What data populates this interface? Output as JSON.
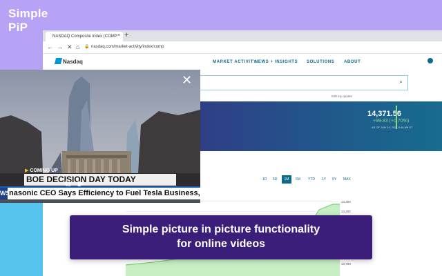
{
  "brand": {
    "line1": "Simple",
    "line2": "PiP"
  },
  "browser": {
    "tab_title": "NASDAQ Composite Index (COMP",
    "tab_close": "×",
    "new_tab": "+",
    "back": "←",
    "forward": "→",
    "reload": "✕",
    "home": "⌂",
    "lock": "🔒",
    "url": "nasdaq.com/market-activity/index/comp"
  },
  "site": {
    "logo": "Nasdaq",
    "menu": [
      "MARKET ACTIVITY",
      "NEWS + INSIGHTS",
      "SOLUTIONS",
      "ABOUT"
    ],
    "search_icon": "⌕",
    "edit_quotes": "Edit my quotes",
    "quote": {
      "price": "14,371.56",
      "change": "+99.83 (+0.70%)",
      "as_of": "AS OF JUN 24, 2021 9:46 AM ET"
    },
    "ranges": [
      "1D",
      "5D",
      "1M",
      "6M",
      "YTD",
      "1Y",
      "5Y",
      "MAX"
    ],
    "active_range": "1M",
    "y_ticks": [
      "14,300",
      "14,200",
      "13,700"
    ]
  },
  "pip": {
    "close": "✕",
    "coming_up": "COMING UP",
    "headline": "BOE DECISION DAY TODAY",
    "ticker_label": "WS",
    "ticker": "nasonic CEO Says Efficiency to Fuel Tesla Business, Growth",
    "controls": "⧉▶"
  },
  "caption": {
    "line1": "Simple picture in picture functionality",
    "line2": "for online videos"
  },
  "colors": {
    "background_purple": "#b6a3f6",
    "background_blue": "#57c4ee",
    "caption_bg": "#3b1d7a",
    "nasdaq_teal": "#0e6a8a",
    "positive_green": "#8bd889"
  }
}
